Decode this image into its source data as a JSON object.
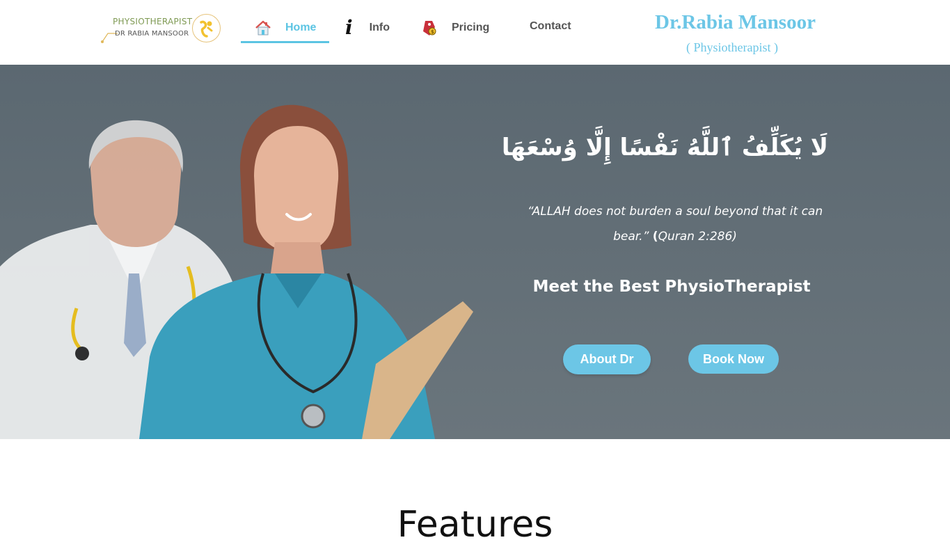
{
  "header": {
    "logo": {
      "line1": "PHYSIOTHERAPIST",
      "line2": "DR RABIA MANSOOR",
      "icon": "physio-logo-icon"
    },
    "nav": [
      {
        "label": "Home",
        "icon": "home-icon",
        "active": true
      },
      {
        "label": "Info",
        "icon": "info-icon"
      },
      {
        "label": "Pricing",
        "icon": "price-tag-icon"
      },
      {
        "label": "Contact"
      }
    ],
    "brand_name": "Dr.Rabia Mansoor",
    "brand_subtitle": "( Physiotherapist )"
  },
  "hero": {
    "ayah": "لَا يُكَلِّفُ ٱللَّهُ نَفْسًا إِلَّا وُسْعَهَا",
    "quote_text": "“ALLAH does not burden a soul beyond that it can bear.” ",
    "quote_open_paren": "(",
    "quote_ref": "Quran 2:286)",
    "headline": "Meet the Best PhysioTherapist",
    "buttons": {
      "about": "About Dr",
      "book": "Book Now"
    }
  },
  "features": {
    "title": "Features"
  },
  "colors": {
    "accent": "#6cc6e6",
    "hero_overlay": "#5f6b73",
    "logo_green": "#7f9a54"
  }
}
